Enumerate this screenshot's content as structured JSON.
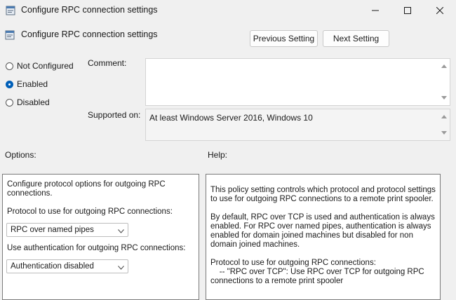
{
  "window": {
    "title": "Configure RPC connection settings",
    "minimize_icon": "minimize-icon",
    "maximize_icon": "maximize-icon",
    "close_icon": "close-icon"
  },
  "header": {
    "title": "Configure RPC connection settings",
    "icon": "policy-icon"
  },
  "nav": {
    "previous_label": "Previous Setting",
    "next_label": "Next Setting"
  },
  "state": {
    "options": [
      {
        "label": "Not Configured",
        "selected": false
      },
      {
        "label": "Enabled",
        "selected": true
      },
      {
        "label": "Disabled",
        "selected": false
      }
    ]
  },
  "comment": {
    "label": "Comment:",
    "value": ""
  },
  "supported": {
    "label": "Supported on:",
    "value": "At least Windows Server 2016, Windows 10"
  },
  "options_panel": {
    "heading": "Options:",
    "description": "Configure protocol options for outgoing RPC connections.",
    "protocol_label": "Protocol to use for outgoing RPC connections:",
    "protocol_value": "RPC over named pipes",
    "auth_label": "Use authentication for outgoing RPC connections:",
    "auth_value": "Authentication disabled"
  },
  "help_panel": {
    "heading": "Help:",
    "text": "This policy setting controls which protocol and protocol settings to use for outgoing RPC connections to a remote print spooler.\n\nBy default, RPC over TCP is used and authentication is always enabled. For RPC over named pipes, authentication is always enabled for domain joined machines but disabled for non domain joined machines.\n\nProtocol to use for outgoing RPC connections:\n    -- \"RPC over TCP\": Use RPC over TCP for outgoing RPC connections to a remote print spooler"
  }
}
